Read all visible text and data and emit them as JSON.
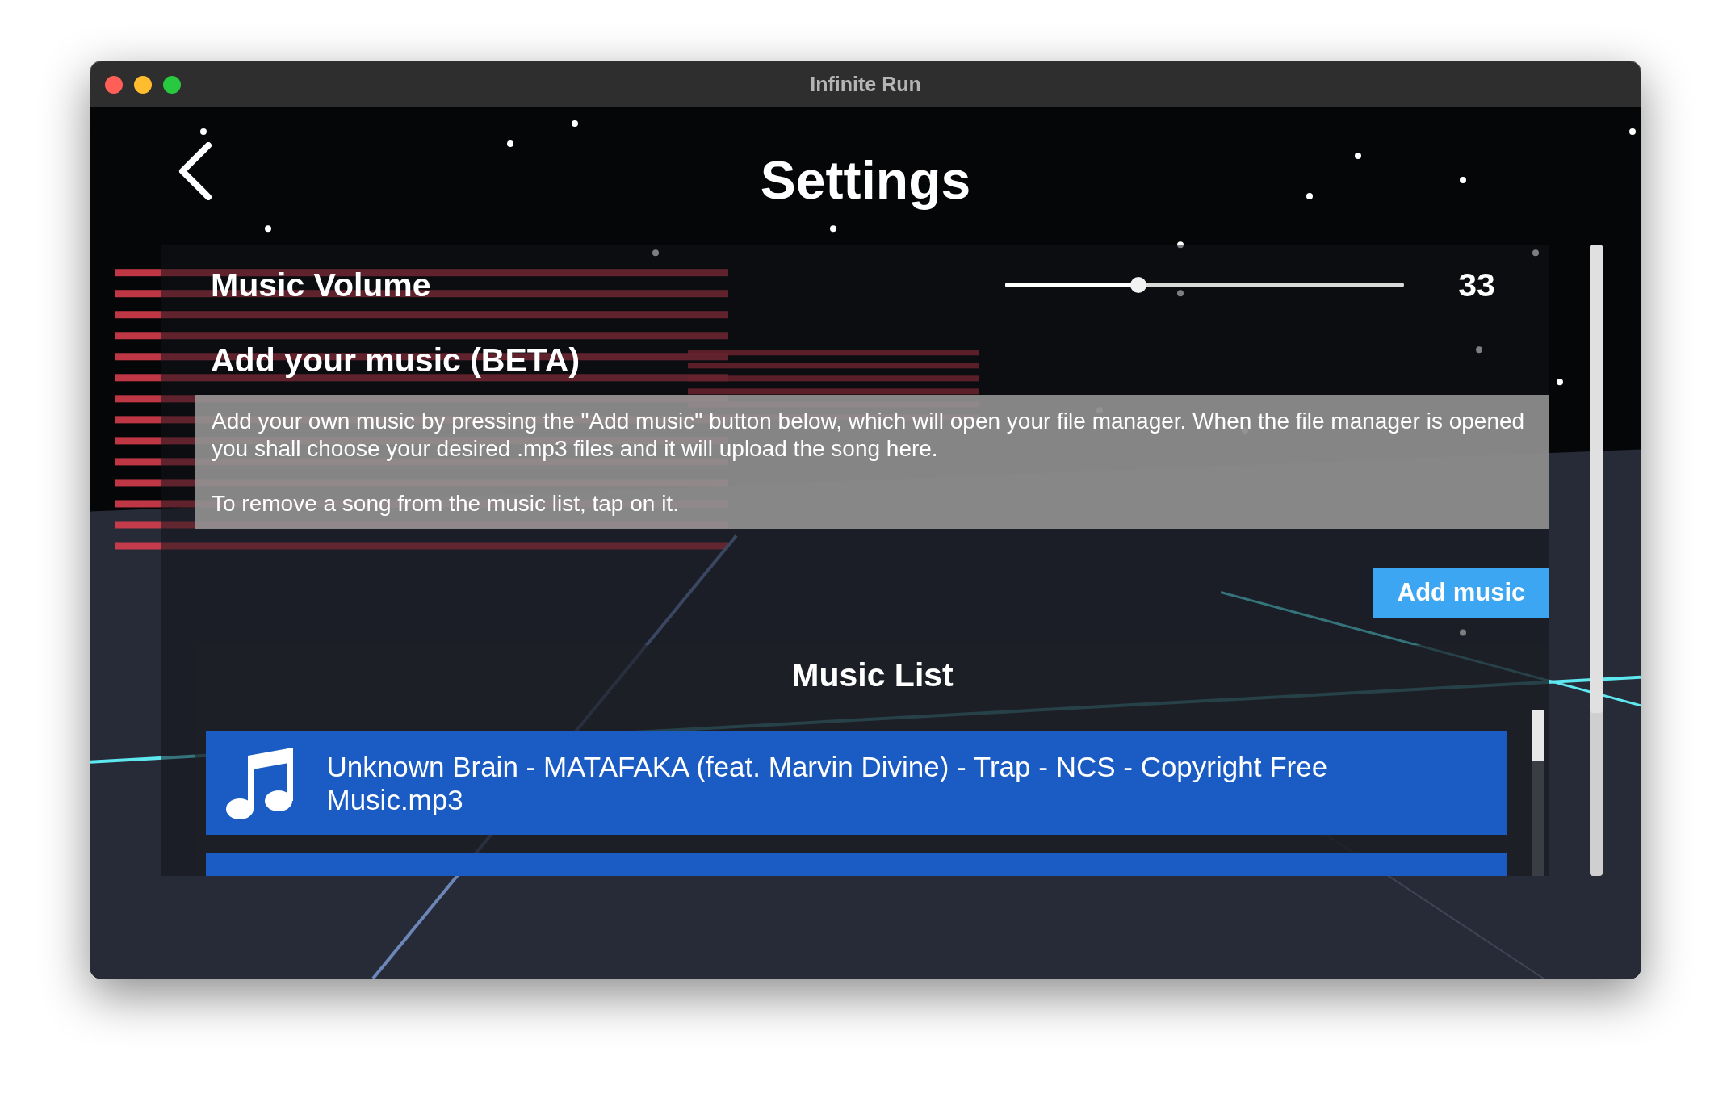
{
  "window": {
    "title": "Infinite Run"
  },
  "screen": {
    "title": "Settings"
  },
  "volume": {
    "label": "Music Volume",
    "level": 0.335,
    "reading": "33"
  },
  "add_music": {
    "heading": "Add your music (BETA)",
    "paragraphs": [
      "Add your own music by pressing the \"Add music\" button below, which will open your file manager. When the file manager is opened you shall choose your desired .mp3 files and it will upload the song here.",
      "To remove a song from the music list, tap on it."
    ],
    "button": "Add music"
  },
  "music_list": {
    "title": "Music List",
    "songs": [
      {
        "name": "Unknown Brain - MATAFAKA (feat. Marvin Divine) - Trap - NCS - Copyright Free Music.mp3"
      }
    ]
  }
}
